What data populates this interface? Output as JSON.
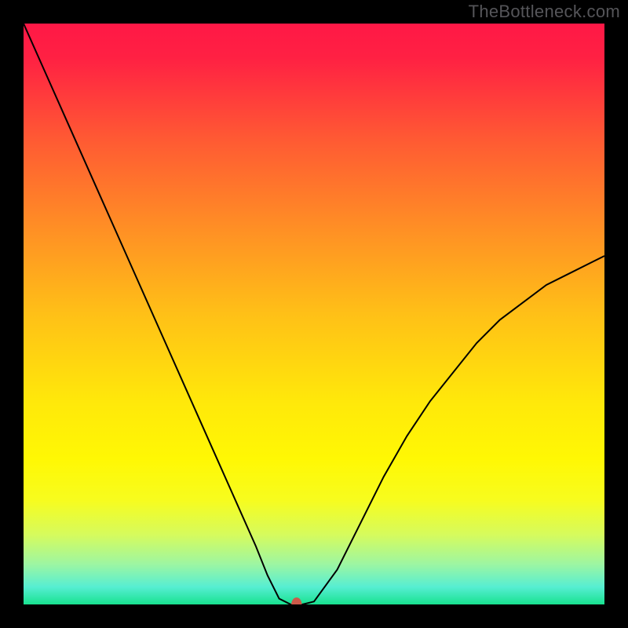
{
  "watermark": "TheBottleneck.com",
  "chart_data": {
    "type": "line",
    "title": "",
    "xlabel": "",
    "ylabel": "",
    "xlim": [
      0,
      100
    ],
    "ylim": [
      0,
      100
    ],
    "grid": false,
    "legend": false,
    "background": {
      "type": "vertical-gradient",
      "stops": [
        {
          "offset": 0.0,
          "color": "#ff1846"
        },
        {
          "offset": 0.06,
          "color": "#ff2143"
        },
        {
          "offset": 0.2,
          "color": "#ff5a33"
        },
        {
          "offset": 0.35,
          "color": "#ff8e25"
        },
        {
          "offset": 0.5,
          "color": "#ffc017"
        },
        {
          "offset": 0.65,
          "color": "#ffe80a"
        },
        {
          "offset": 0.75,
          "color": "#fff804"
        },
        {
          "offset": 0.82,
          "color": "#f7fc1e"
        },
        {
          "offset": 0.88,
          "color": "#d6fb5d"
        },
        {
          "offset": 0.93,
          "color": "#9ef6a1"
        },
        {
          "offset": 0.97,
          "color": "#56eed2"
        },
        {
          "offset": 1.0,
          "color": "#18e28f"
        }
      ]
    },
    "series": [
      {
        "name": "bottleneck-curve",
        "color": "#000000",
        "x": [
          0,
          4,
          8,
          12,
          16,
          20,
          24,
          28,
          32,
          36,
          40,
          42,
          44,
          46,
          48,
          50,
          54,
          58,
          62,
          66,
          70,
          74,
          78,
          82,
          86,
          90,
          94,
          98,
          100
        ],
        "y": [
          100,
          91,
          82,
          73,
          64,
          55,
          46,
          37,
          28,
          19,
          10,
          5,
          1,
          0,
          0,
          0.5,
          6,
          14,
          22,
          29,
          35,
          40,
          45,
          49,
          52,
          55,
          57,
          59,
          60
        ]
      }
    ],
    "marker": {
      "name": "optimal-point",
      "x": 47,
      "y": 0,
      "color": "#cc5a4a",
      "rx": 0.9,
      "ry": 1.2
    }
  }
}
